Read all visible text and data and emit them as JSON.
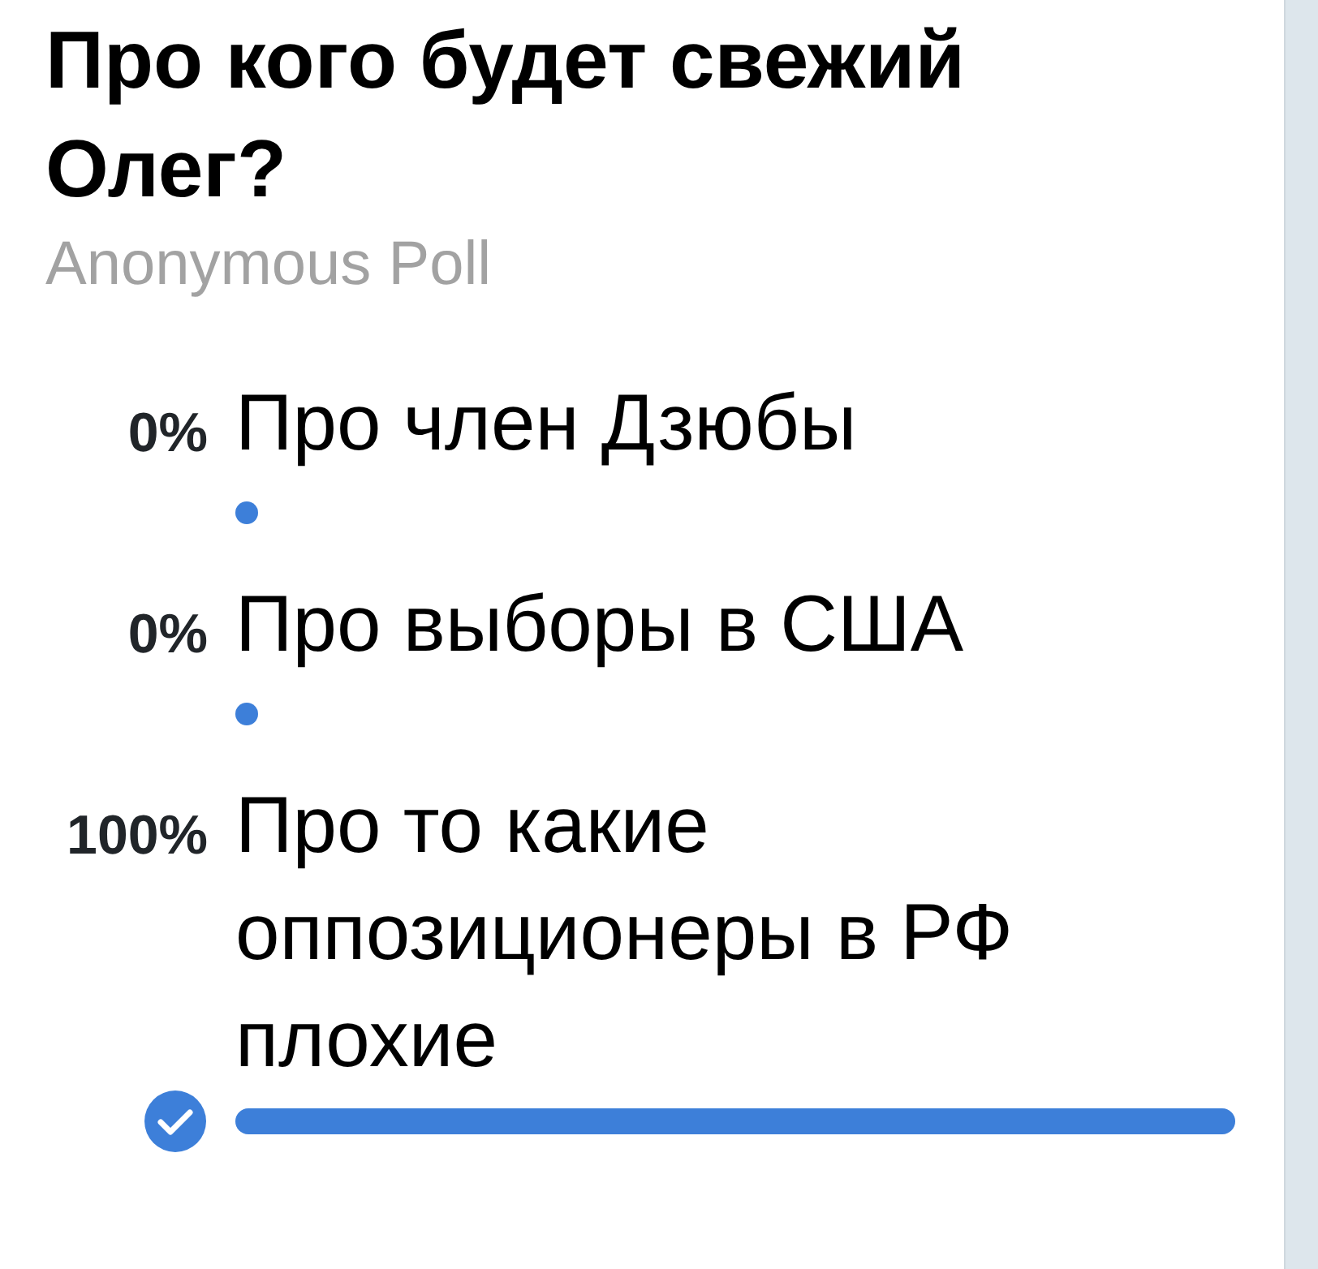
{
  "poll": {
    "question": "Про кого будет свежий Олег?",
    "type_label": "Anonymous Poll",
    "options": [
      {
        "percent": "0%",
        "text": "Про член Дзюбы",
        "selected": false
      },
      {
        "percent": "0%",
        "text": "Про выборы в США",
        "selected": false
      },
      {
        "percent": "100%",
        "text": "Про то какие оппозиционеры в РФ плохие",
        "level": 1,
        "selected": true
      }
    ]
  }
}
